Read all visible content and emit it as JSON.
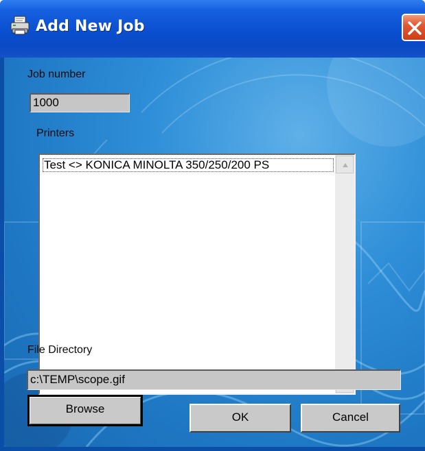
{
  "window": {
    "title": "Add New Job",
    "icon": "printer-icon",
    "close_icon": "close-icon",
    "accent_color": "#0a4fd0",
    "close_color": "#d9522b"
  },
  "form": {
    "job_number_label": "Job number",
    "job_number_value": "1000",
    "printers_label": "Printers",
    "printers": [
      "Test <> KONICA MINOLTA 350/250/200 PS"
    ],
    "file_directory_label": "File Directory",
    "file_directory_value": "c:\\TEMP\\scope.gif"
  },
  "buttons": {
    "browse": "Browse",
    "ok": "OK",
    "cancel": "Cancel"
  }
}
